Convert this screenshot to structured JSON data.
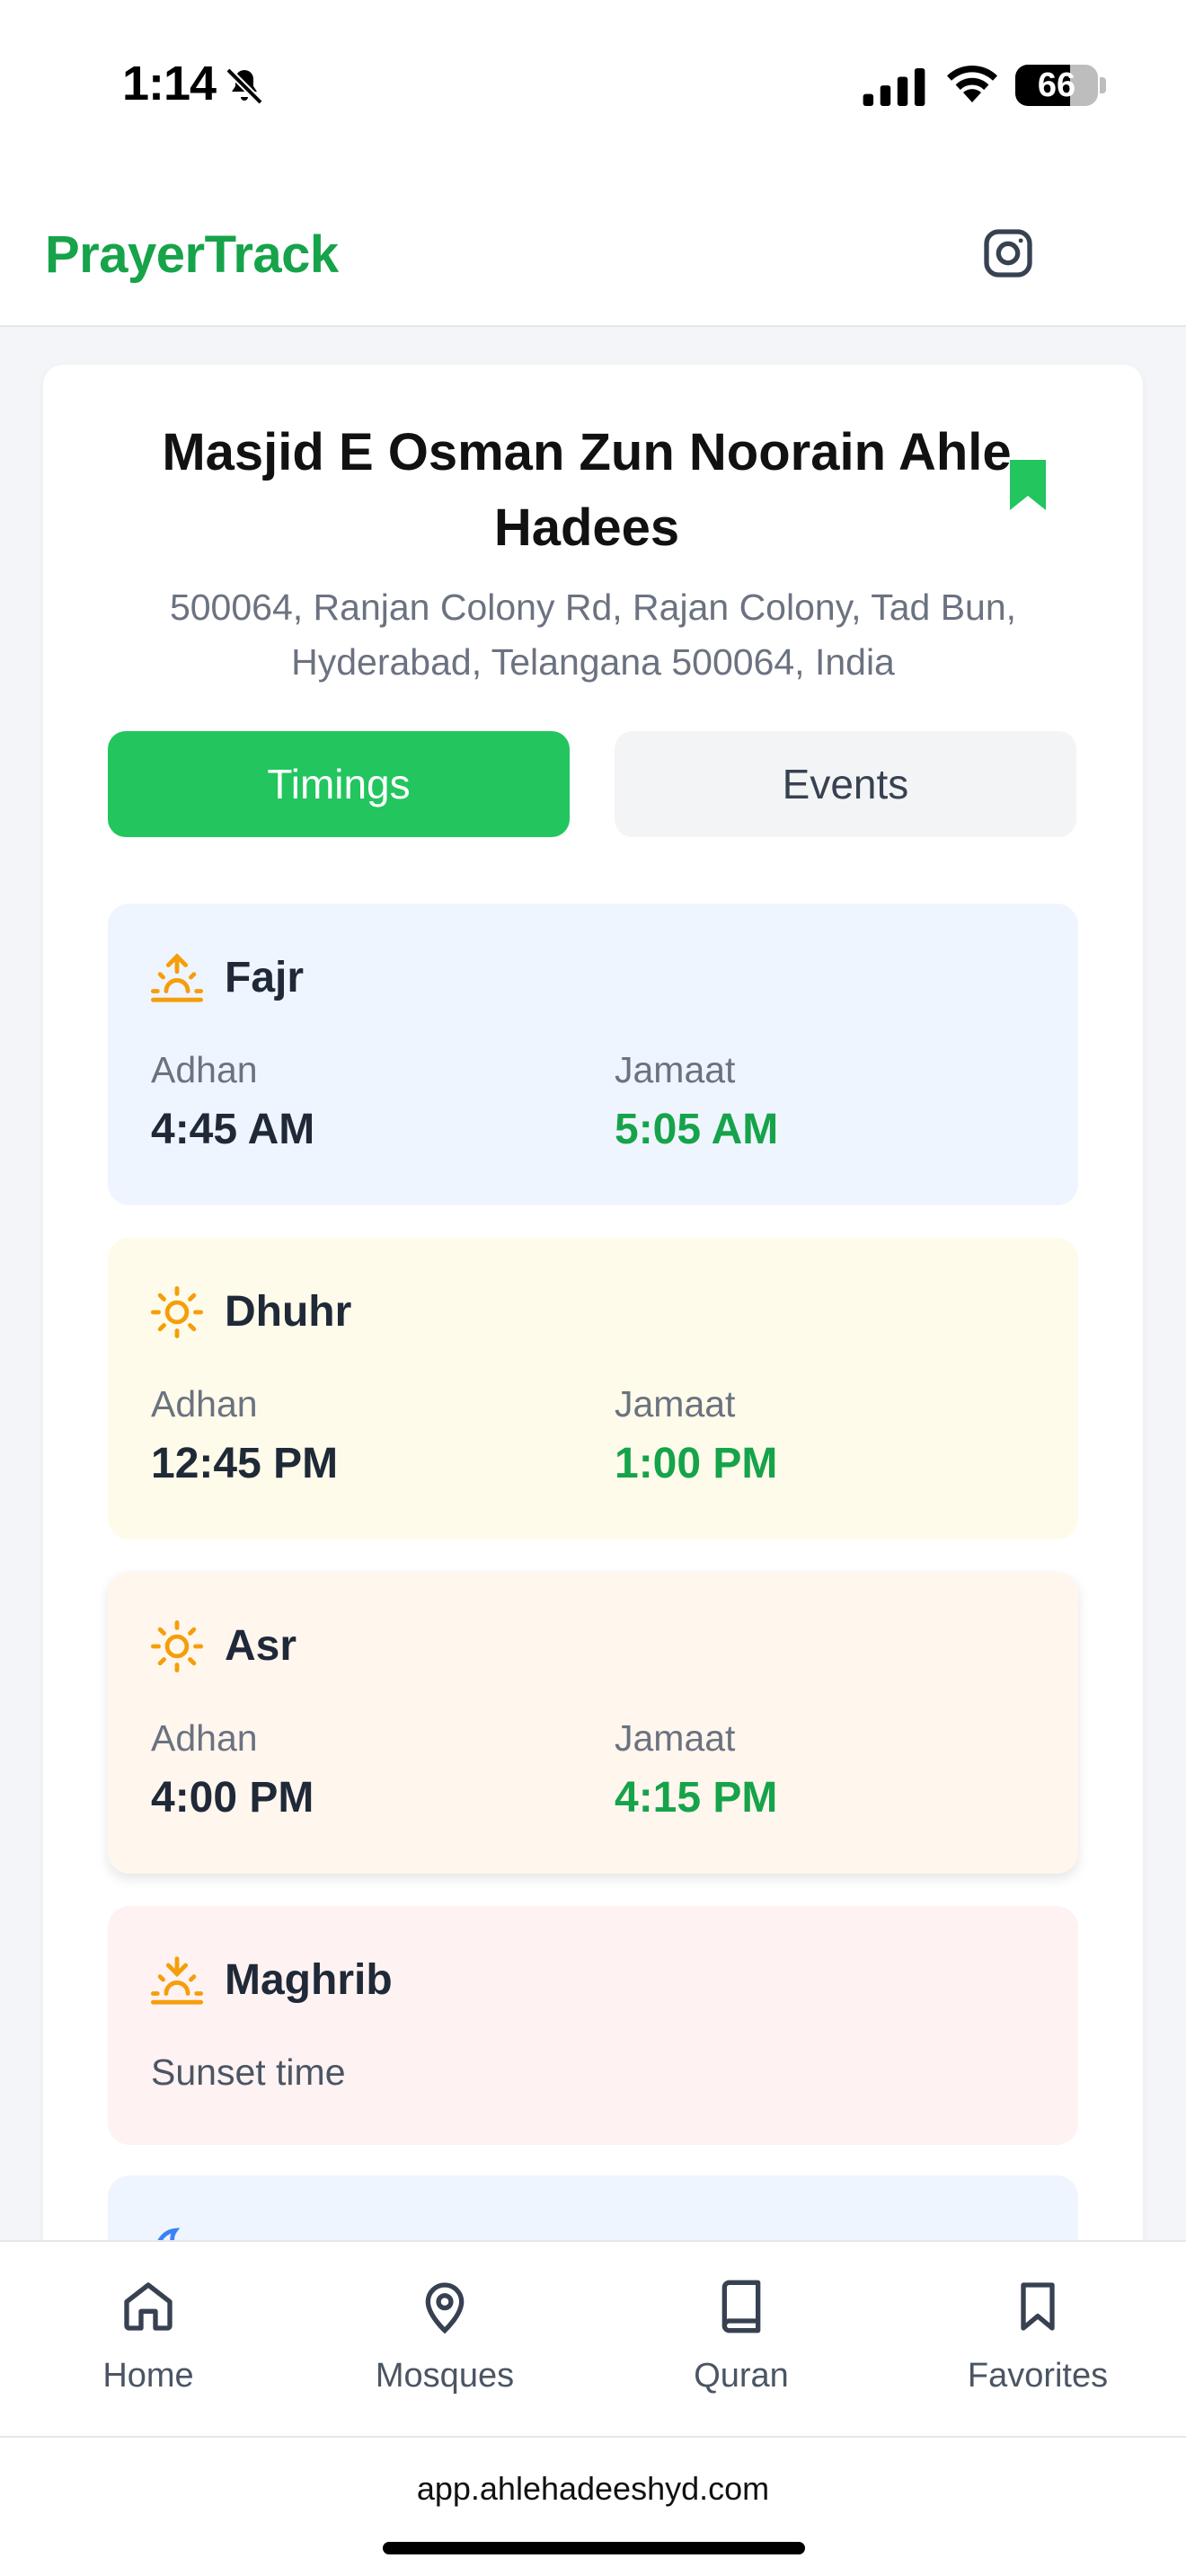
{
  "status_bar": {
    "time": "1:14",
    "battery": "66",
    "battery_level_percent": 66,
    "icons": [
      "bell-slash-icon",
      "cellular-signal-icon",
      "wifi-icon",
      "battery-icon"
    ]
  },
  "header": {
    "brand": "PrayerTrack",
    "icon": "instagram-icon"
  },
  "mosque": {
    "name": "Masjid E Osman Zun Noorain Ahle Hadees",
    "address": "500064, Ranjan Colony Rd, Rajan Colony, Tad Bun, Hyderabad, Telangana 500064, India",
    "bookmark_icon": "bookmark-filled-icon"
  },
  "tabs": [
    {
      "label": "Timings",
      "active": true
    },
    {
      "label": "Events",
      "active": false
    }
  ],
  "prayers": [
    {
      "name": "Fajr",
      "icon": "sunrise-icon",
      "adhan_label": "Adhan",
      "adhan": "4:45 AM",
      "jamaat_label": "Jamaat",
      "jamaat": "5:05 AM"
    },
    {
      "name": "Dhuhr",
      "icon": "sun-icon",
      "adhan_label": "Adhan",
      "adhan": "12:45 PM",
      "jamaat_label": "Jamaat",
      "jamaat": "1:00 PM"
    },
    {
      "name": "Asr",
      "icon": "sun-icon",
      "adhan_label": "Adhan",
      "adhan": "4:00 PM",
      "jamaat_label": "Jamaat",
      "jamaat": "4:15 PM"
    },
    {
      "name": "Maghrib",
      "icon": "sunset-icon",
      "note": "Sunset time"
    },
    {
      "icon": "moon-icon"
    }
  ],
  "colors": {
    "brand_green": "#16a34a",
    "tab_active": "#22c55e",
    "icon_orange": "#f59e0b",
    "isha_icon_blue": "#3b82f6"
  },
  "bottom_nav": [
    {
      "label": "Home",
      "icon": "home-icon"
    },
    {
      "label": "Mosques",
      "icon": "map-pin-icon"
    },
    {
      "label": "Quran",
      "icon": "book-icon"
    },
    {
      "label": "Favorites",
      "icon": "bookmark-icon"
    }
  ],
  "browser": {
    "url": "app.ahlehadeeshyd.com"
  }
}
